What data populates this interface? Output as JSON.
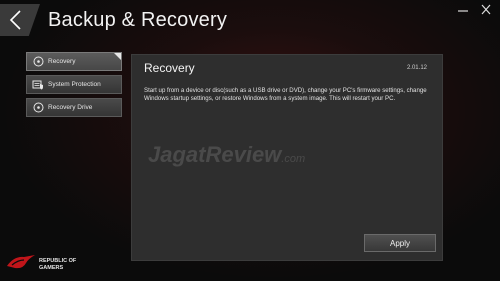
{
  "window": {
    "title": "Backup & Recovery"
  },
  "icons": {
    "back": "chevron-left-icon",
    "minimize": "minimize-icon",
    "close": "close-icon",
    "recovery": "recovery-disc-icon",
    "system_protection": "shield-drive-icon",
    "recovery_drive": "recovery-drive-icon",
    "brand": "rog-eye-icon"
  },
  "sidebar": {
    "items": [
      {
        "label": "Recovery",
        "active": true
      },
      {
        "label": "System Protection",
        "active": false
      },
      {
        "label": "Recovery Drive",
        "active": false
      }
    ]
  },
  "panel": {
    "title": "Recovery",
    "version": "2.01.12",
    "description": "Start up from a device or disc(such as a USB drive or DVD), change your PC's firmware settings, change Windows startup settings, or restore Windows from a system image. This will restart your PC.",
    "apply_label": "Apply"
  },
  "watermark": {
    "main": "JagatReview",
    "domain": ".com"
  },
  "brand": {
    "line1": "REPUBLIC OF",
    "line2": "GAMERS"
  },
  "colors": {
    "accent": "#c0151a",
    "panel": "#2e2e2e",
    "background": "#0b0b0b"
  }
}
